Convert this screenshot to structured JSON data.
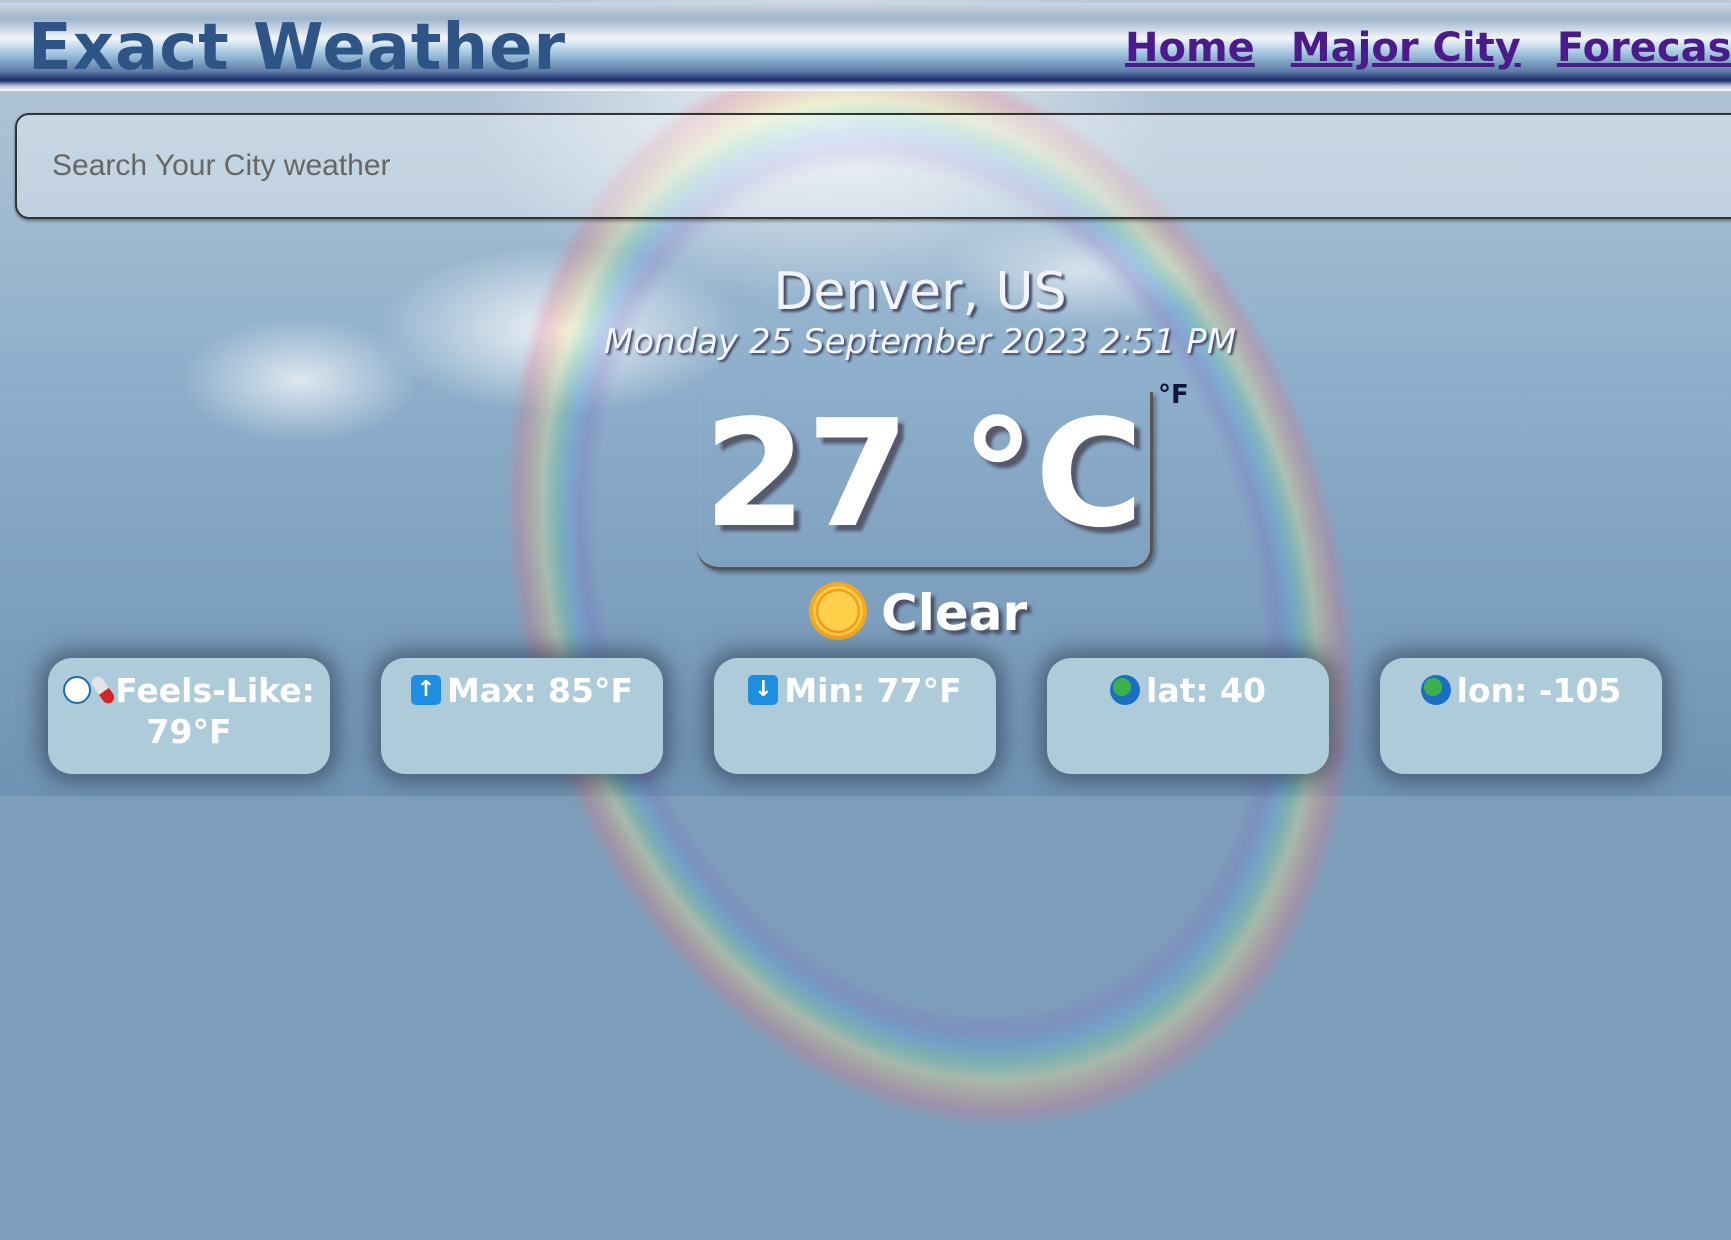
{
  "header": {
    "brand": "Exact Weather",
    "nav": [
      {
        "label": "Home"
      },
      {
        "label": "Major City"
      },
      {
        "label": "Forecast"
      }
    ]
  },
  "search": {
    "placeholder": "Search Your City weather"
  },
  "location": {
    "city": "Denver, US",
    "datetime": "Monday 25 September 2023 2:51 PM"
  },
  "temperature": {
    "value": "27 °C",
    "alt_unit_toggle": "°F"
  },
  "condition": {
    "icon": "smiling-sun-icon",
    "label": "Clear"
  },
  "stats": [
    {
      "icons": [
        "snowman-icon",
        "thermometer-icon"
      ],
      "label": "Feels-Like: 79°F"
    },
    {
      "icons": [
        "up-arrow-icon"
      ],
      "label": "Max: 85°F"
    },
    {
      "icons": [
        "down-arrow-icon"
      ],
      "label": "Min: 77°F"
    },
    {
      "icons": [
        "globe-icon"
      ],
      "label": "lat: 40"
    },
    {
      "icons": [
        "globe-icon"
      ],
      "label": "lon: -105"
    }
  ],
  "colors": {
    "brand": "#2f5586",
    "nav_link": "#4b1b8c",
    "card_bg": "#aecbda",
    "stat_icon_blue": "#1e8fe0"
  }
}
